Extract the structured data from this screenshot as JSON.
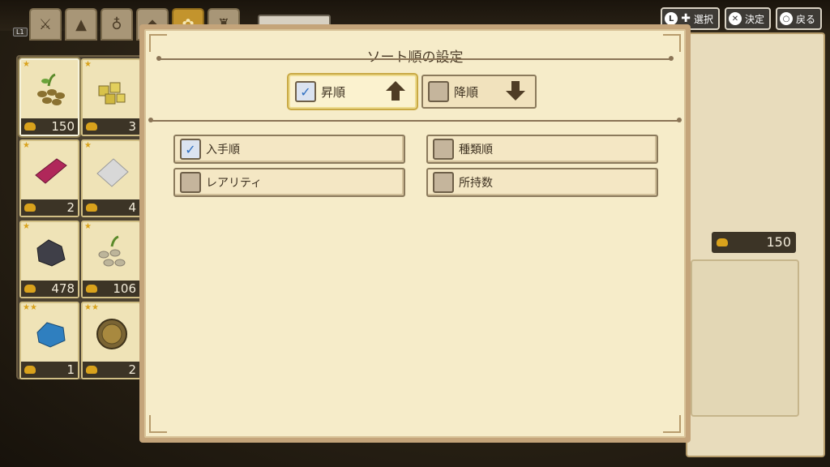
{
  "controls": [
    {
      "icon": "L",
      "label": "選択"
    },
    {
      "icon": "✕",
      "label": "決定"
    },
    {
      "icon": "○",
      "label": "戻る"
    }
  ],
  "tabs_hint": "L1",
  "items": [
    {
      "count": "150",
      "color": "#7a6a2c"
    },
    {
      "count": "3",
      "color": "#c9b34a"
    },
    {
      "count": "2",
      "color": "#b0275a"
    },
    {
      "count": "4",
      "color": "#c9c9c9"
    },
    {
      "count": "478",
      "color": "#3f3f48"
    },
    {
      "count": "106",
      "color": "#bdb59a"
    },
    {
      "count": "1",
      "color": "#2f7fbf"
    },
    {
      "count": "2",
      "color": "#7a6434"
    }
  ],
  "detail": {
    "quantity": "150"
  },
  "dialog": {
    "title": "ソート順の設定",
    "order": [
      {
        "label": "昇順",
        "checked": true
      },
      {
        "label": "降順",
        "checked": false
      }
    ],
    "options": [
      {
        "label": "入手順",
        "checked": true
      },
      {
        "label": "種類順",
        "checked": false
      },
      {
        "label": "レアリティ",
        "checked": false
      },
      {
        "label": "所持数",
        "checked": false
      }
    ]
  }
}
